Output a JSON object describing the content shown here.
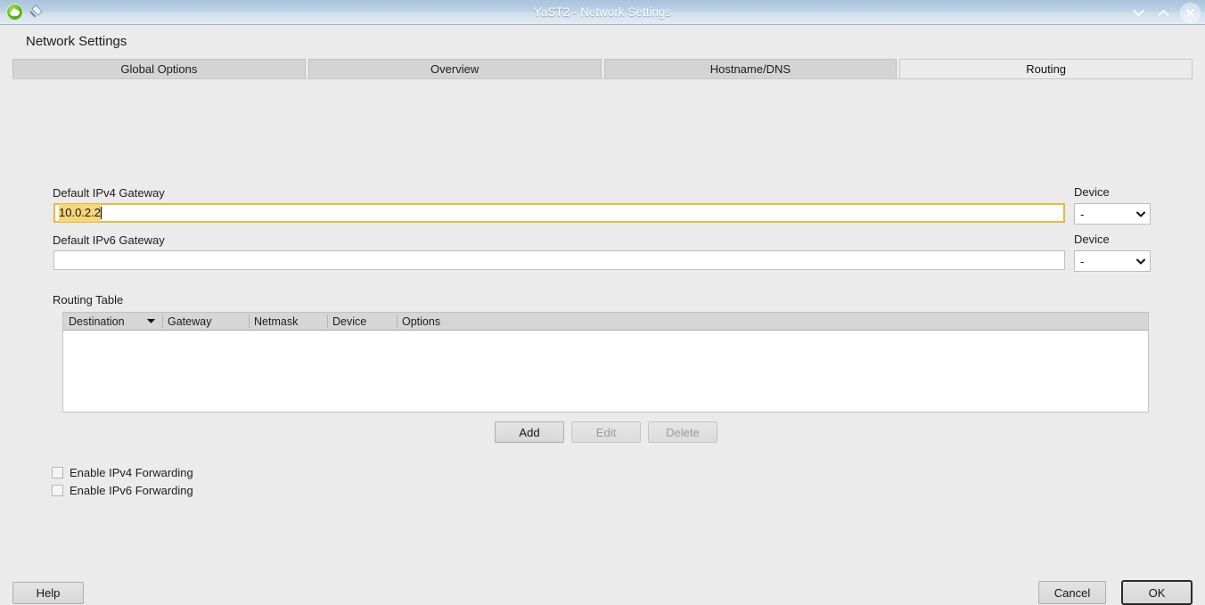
{
  "window": {
    "title": "YaST2 - Network Settings",
    "logo_icon": "yast-chameleon-icon",
    "pin_icon": "pin-icon",
    "controls": {
      "minimize_icon": "chevron-down-icon",
      "maximize_icon": "chevron-up-icon",
      "close_icon": "close-icon"
    }
  },
  "page": {
    "heading": "Network Settings"
  },
  "tabs": [
    {
      "label": "Global Options",
      "active": false
    },
    {
      "label": "Overview",
      "active": false
    },
    {
      "label": "Hostname/DNS",
      "active": false
    },
    {
      "label": "Routing",
      "active": true
    }
  ],
  "routing": {
    "ipv4": {
      "label": "Default IPv4 Gateway",
      "value": "10.0.2.2",
      "placeholder": "",
      "focused": true,
      "device_label": "Device",
      "device_value": "-"
    },
    "ipv6": {
      "label": "Default IPv6 Gateway",
      "value": "",
      "placeholder": "",
      "focused": false,
      "device_label": "Device",
      "device_value": "-"
    },
    "table": {
      "label": "Routing Table",
      "columns": [
        {
          "label": "Destination",
          "sorted": true,
          "sort_icon": "chevron-down-icon"
        },
        {
          "label": "Gateway",
          "sorted": false
        },
        {
          "label": "Netmask",
          "sorted": false
        },
        {
          "label": "Device",
          "sorted": false
        },
        {
          "label": "Options",
          "sorted": false
        }
      ],
      "rows": []
    },
    "table_buttons": [
      {
        "label": "Add",
        "enabled": true
      },
      {
        "label": "Edit",
        "enabled": false
      },
      {
        "label": "Delete",
        "enabled": false
      }
    ],
    "checkboxes": [
      {
        "label": "Enable IPv4 Forwarding",
        "checked": false
      },
      {
        "label": "Enable IPv6 Forwarding",
        "checked": false
      }
    ]
  },
  "footer": {
    "help": "Help",
    "cancel": "Cancel",
    "ok": "OK"
  },
  "colors": {
    "titlebar_start": "#a9c2dd",
    "titlebar_end": "#e3ecf4",
    "page_bg": "#ebebeb",
    "tab_inactive": "#d4d4d4",
    "tab_active": "#ebebeb",
    "focus_border": "#e9b83c",
    "selection": "#f5d67a",
    "header_bg": "#d6d6d6"
  }
}
